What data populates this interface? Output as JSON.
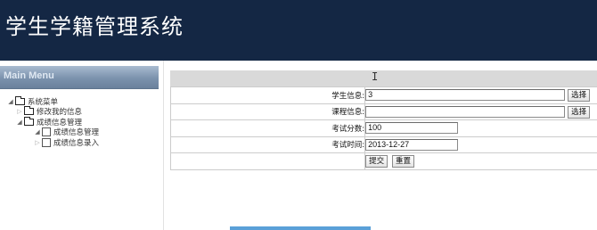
{
  "header": {
    "title": "学生学籍管理系统"
  },
  "sidebar": {
    "menu_title": "Main Menu",
    "tree": [
      {
        "label": "系统菜单",
        "level": 0,
        "expanded": true,
        "icon": "folder-icon"
      },
      {
        "label": "修改我的信息",
        "level": 1,
        "expanded": false,
        "icon": "folder-icon"
      },
      {
        "label": "成绩信息管理",
        "level": 1,
        "expanded": true,
        "icon": "folder-icon"
      },
      {
        "label": "成绩信息管理",
        "level": 2,
        "expanded": true,
        "icon": "document-icon"
      },
      {
        "label": "成绩信息录入",
        "level": 2,
        "expanded": false,
        "icon": "document-icon"
      }
    ]
  },
  "form": {
    "student_label": "学生信息:",
    "student_value": "3",
    "student_select": "选择",
    "course_label": "课程信息:",
    "course_value": "",
    "course_select": "选择",
    "score_label": "考试分数:",
    "score_value": "100",
    "date_label": "考试时间:",
    "date_value": "2013-12-27",
    "submit_label": "提交",
    "reset_label": "重置"
  },
  "colors": {
    "header_bg": "#142744",
    "menu_bar": "#7b92ad",
    "progress": "#5aa0d8"
  }
}
